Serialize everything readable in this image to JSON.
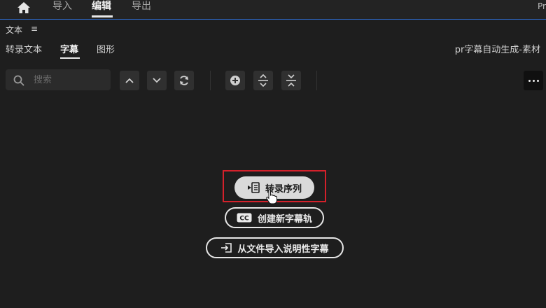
{
  "topbar": {
    "tabs": [
      {
        "label": "导入"
      },
      {
        "label": "编辑"
      },
      {
        "label": "导出"
      }
    ],
    "corner_text": "Pr"
  },
  "panel": {
    "title": "文本",
    "menu_icon": "hamburger-icon",
    "tabs": [
      {
        "label": "转录文本"
      },
      {
        "label": "字幕"
      },
      {
        "label": "图形"
      }
    ],
    "active_tab": "字幕",
    "sequence_name": "pr字幕自动生成-素材"
  },
  "toolbar": {
    "search_placeholder": "搜索",
    "icons": [
      "search-icon",
      "chevron-up-icon",
      "chevron-down-icon",
      "refresh-icon",
      "add-circle-icon",
      "expand-icon",
      "collapse-icon",
      "more-icon"
    ]
  },
  "actions": {
    "transcribe_label": "转录序列",
    "create_captions_label": "创建新字幕轨",
    "import_captions_label": "从文件导入说明性字幕"
  },
  "colors": {
    "background": "#1e1e1e",
    "accent_line": "#2f6fd6",
    "highlight": "#d4212b",
    "primary_button": "#dadada"
  }
}
